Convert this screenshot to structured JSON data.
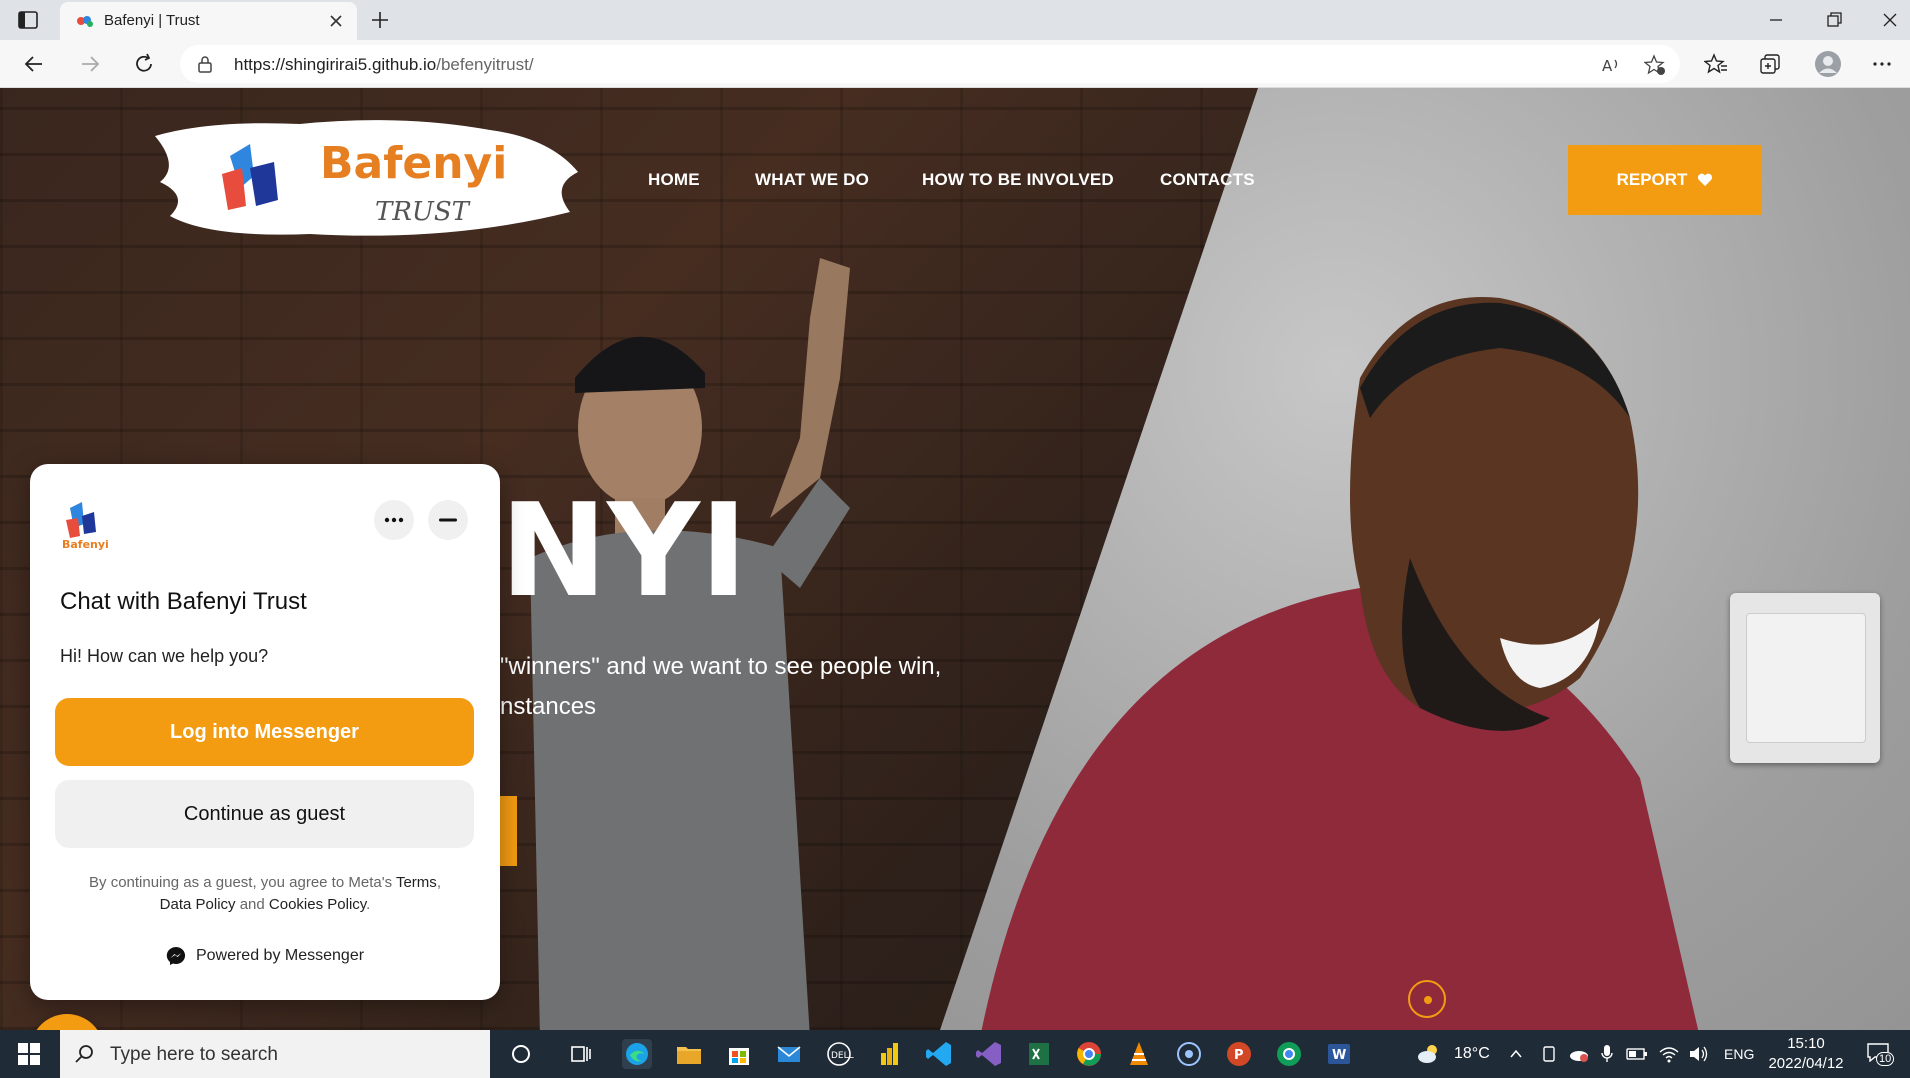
{
  "browser": {
    "tab_title": "Bafenyi | Trust",
    "url_main": "https://shingirirai5.github.io",
    "url_path": "/befenyitrust/"
  },
  "site": {
    "logo_word1": "Bafenyi",
    "logo_word2": "TRUST",
    "nav": [
      "HOME",
      "WHAT WE DO",
      "HOW TO BE INVOLVED",
      "CONTACTS"
    ],
    "report_label": "REPORT",
    "hero_title": "NYI",
    "hero_line1": "\"winners\" and we want to see people win,",
    "hero_line2": "nstances",
    "accent_color": "#f39c12"
  },
  "chat": {
    "title": "Chat with Bafenyi Trust",
    "greeting": "Hi! How can we help you?",
    "login_label": "Log into Messenger",
    "guest_label": "Continue as guest",
    "legal_prefix": "By continuing as a guest, you agree to Meta's",
    "terms": "Terms",
    "data_policy": "Data Policy",
    "and": "and",
    "cookies": "Cookies Policy",
    "powered": "Powered by Messenger"
  },
  "taskbar": {
    "search_placeholder": "Type here to search",
    "temperature": "18°C",
    "language": "ENG",
    "time": "15:10",
    "date": "2022/04/12",
    "notifications": "10"
  }
}
